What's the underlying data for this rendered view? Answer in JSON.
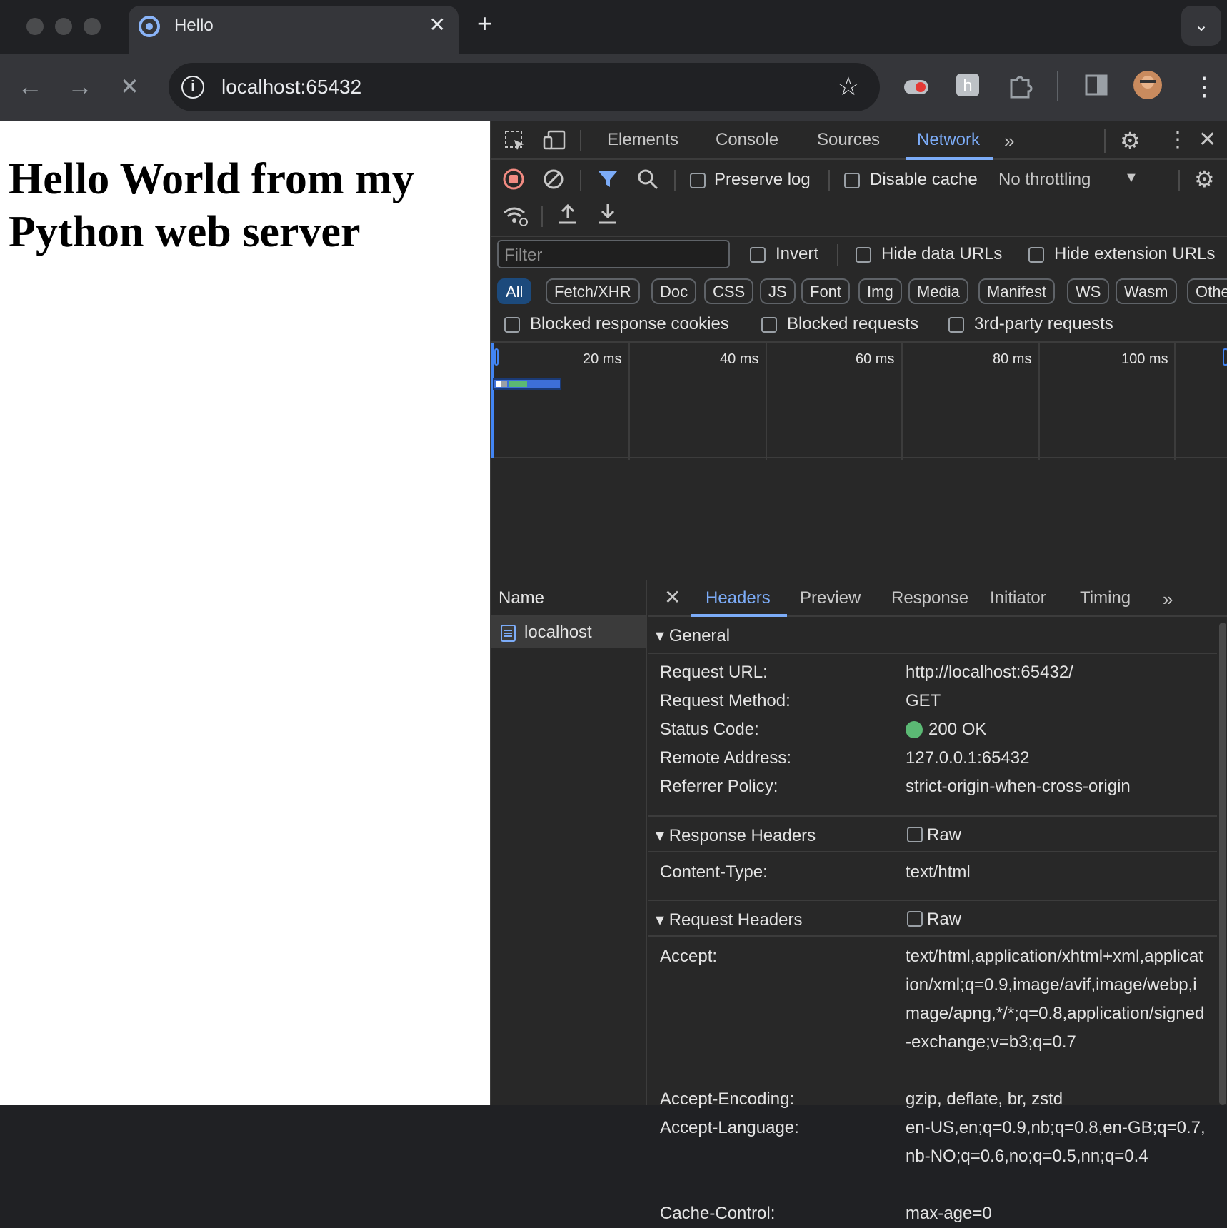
{
  "browser": {
    "tab_title": "Hello",
    "tab_close": "✕",
    "new_tab": "+",
    "tab_menu": "⌄",
    "url": "localhost:65432"
  },
  "page": {
    "heading": "Hello World from my Python web server"
  },
  "devtools": {
    "tabs": [
      "Elements",
      "Console",
      "Sources",
      "Network"
    ],
    "active_tab": "Network",
    "network_toolbar": {
      "preserve_log": "Preserve log",
      "disable_cache": "Disable cache",
      "throttling": "No throttling"
    },
    "filter": {
      "placeholder": "Filter",
      "invert": "Invert",
      "hide_data_urls": "Hide data URLs",
      "hide_extension_urls": "Hide extension URLs",
      "types": [
        "All",
        "Fetch/XHR",
        "Doc",
        "CSS",
        "JS",
        "Font",
        "Img",
        "Media",
        "Manifest",
        "WS",
        "Wasm",
        "Othe"
      ],
      "blocked_cookies": "Blocked response cookies",
      "blocked_requests": "Blocked requests",
      "third_party": "3rd-party requests"
    },
    "timeline_ticks": [
      "20 ms",
      "40 ms",
      "60 ms",
      "80 ms",
      "100 ms"
    ],
    "request_list": {
      "column": "Name",
      "rows": [
        "localhost"
      ]
    },
    "detail_tabs": [
      "Headers",
      "Preview",
      "Response",
      "Initiator",
      "Timing"
    ],
    "general": {
      "title": "General",
      "rows": [
        {
          "k": "Request URL:",
          "v": "http://localhost:65432/"
        },
        {
          "k": "Request Method:",
          "v": "GET"
        },
        {
          "k": "Status Code:",
          "v": "200 OK"
        },
        {
          "k": "Remote Address:",
          "v": "127.0.0.1:65432"
        },
        {
          "k": "Referrer Policy:",
          "v": "strict-origin-when-cross-origin"
        }
      ]
    },
    "response_headers": {
      "title": "Response Headers",
      "raw": "Raw",
      "rows": [
        {
          "k": "Content-Type:",
          "v": "text/html"
        }
      ]
    },
    "request_headers": {
      "title": "Request Headers",
      "raw": "Raw",
      "rows": [
        {
          "k": "Accept:",
          "v": "text/html,application/xhtml+xml,application/xml;q=0.9,image/avif,image/webp,image/apng,*/*;q=0.8,application/signed-exchange;v=b3;q=0.7"
        },
        {
          "k": "Accept-Encoding:",
          "v": "gzip, deflate, br, zstd"
        },
        {
          "k": "Accept-Language:",
          "v": "en-US,en;q=0.9,nb;q=0.8,en-GB;q=0.7,nb-NO;q=0.6,no;q=0.5,nn;q=0.4"
        },
        {
          "k": "Cache-Control:",
          "v": "max-age=0"
        }
      ]
    },
    "colors": {
      "accent": "#7cacf8",
      "status_ok": "#5bb974"
    }
  }
}
